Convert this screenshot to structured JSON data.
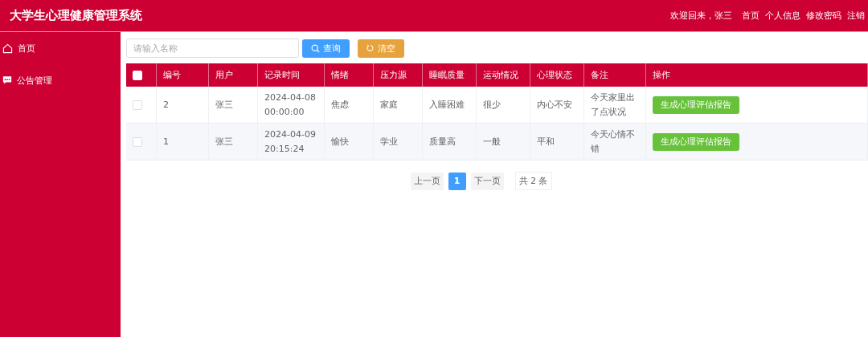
{
  "header": {
    "title": "大学生心理健康管理系统",
    "welcome": "欢迎回来，张三",
    "links": [
      "首页",
      "个人信息",
      "修改密码",
      "注销"
    ]
  },
  "sidebar": {
    "items": [
      {
        "label": "首页",
        "kind": "home",
        "selected": false
      },
      {
        "label": "公告管理",
        "kind": "chat",
        "selected": false
      }
    ]
  },
  "search": {
    "placeholder": "请输入名称",
    "buttons": [
      {
        "label": "查询",
        "kind": "search"
      },
      {
        "label": "清空",
        "kind": "reset"
      }
    ]
  },
  "table": {
    "select_all": {
      "checked": false
    },
    "columns": [
      "编号",
      "用户",
      "记录时间",
      "情绪",
      "压力源",
      "睡眠质量",
      "运动情况",
      "心理状态",
      "备注",
      "操作"
    ],
    "rows": [
      {
        "checked": false,
        "cells": [
          "2",
          "张三",
          "2024-04-08 00:00:00",
          "焦虑",
          "家庭",
          "入睡困难",
          "很少",
          "内心不安",
          "今天家里出了点状况"
        ],
        "action": "生成心理评估报告"
      },
      {
        "checked": false,
        "cells": [
          "1",
          "张三",
          "2024-04-09 20:15:24",
          "愉快",
          "学业",
          "质量高",
          "一般",
          "平和",
          "今天心情不错"
        ],
        "action": "生成心理评估报告"
      }
    ]
  },
  "pagination": {
    "prev": "上一页",
    "pages": [
      {
        "label": "1",
        "selected": true
      }
    ],
    "next": "下一页",
    "total": "共 2 条"
  }
}
